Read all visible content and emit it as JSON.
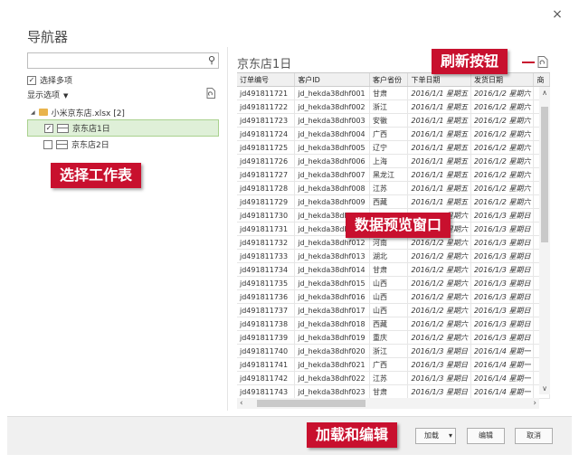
{
  "dialog": {
    "title": "导航器",
    "close_label": "×",
    "search": {
      "placeholder": "",
      "icon": "search-icon"
    },
    "select_multiple_label": "选择多项",
    "display_options_label": "显示选项",
    "display_options_arrow": "▼"
  },
  "tree": {
    "folder_label": "小米京东店.xlsx [2]",
    "items": [
      {
        "label": "京东店1日",
        "checked": "✓",
        "selected": true
      },
      {
        "label": "京东店2日",
        "checked": "",
        "selected": false
      }
    ]
  },
  "preview": {
    "title": "京东店1日",
    "columns": [
      "订单编号",
      "客户ID",
      "客户省份",
      "下单日期",
      "发货日期",
      "商"
    ],
    "rows": [
      [
        "jd491811721",
        "jd_hekda38dhf001",
        "甘肃",
        "2016/1/1 星期五",
        "2016/1/2 星期六"
      ],
      [
        "jd491811722",
        "jd_hekda38dhf002",
        "浙江",
        "2016/1/1 星期五",
        "2016/1/2 星期六"
      ],
      [
        "jd491811723",
        "jd_hekda38dhf003",
        "安徽",
        "2016/1/1 星期五",
        "2016/1/2 星期六"
      ],
      [
        "jd491811724",
        "jd_hekda38dhf004",
        "广西",
        "2016/1/1 星期五",
        "2016/1/2 星期六"
      ],
      [
        "jd491811725",
        "jd_hekda38dhf005",
        "辽宁",
        "2016/1/1 星期五",
        "2016/1/2 星期六"
      ],
      [
        "jd491811726",
        "jd_hekda38dhf006",
        "上海",
        "2016/1/1 星期五",
        "2016/1/2 星期六"
      ],
      [
        "jd491811727",
        "jd_hekda38dhf007",
        "黑龙江",
        "2016/1/1 星期五",
        "2016/1/2 星期六"
      ],
      [
        "jd491811728",
        "jd_hekda38dhf008",
        "江苏",
        "2016/1/1 星期五",
        "2016/1/2 星期六"
      ],
      [
        "jd491811729",
        "jd_hekda38dhf009",
        "西藏",
        "2016/1/1 星期五",
        "2016/1/2 星期六"
      ],
      [
        "jd491811730",
        "jd_hekda38dhf010",
        "",
        "2016/1/2 星期六",
        "2016/1/3 星期日"
      ],
      [
        "jd491811731",
        "jd_hekda38dhf011",
        "",
        "2016/1/2 星期六",
        "2016/1/3 星期日"
      ],
      [
        "jd491811732",
        "jd_hekda38dhf012",
        "河南",
        "2016/1/2 星期六",
        "2016/1/3 星期日"
      ],
      [
        "jd491811733",
        "jd_hekda38dhf013",
        "湖北",
        "2016/1/2 星期六",
        "2016/1/3 星期日"
      ],
      [
        "jd491811734",
        "jd_hekda38dhf014",
        "甘肃",
        "2016/1/2 星期六",
        "2016/1/3 星期日"
      ],
      [
        "jd491811735",
        "jd_hekda38dhf015",
        "山西",
        "2016/1/2 星期六",
        "2016/1/3 星期日"
      ],
      [
        "jd491811736",
        "jd_hekda38dhf016",
        "山西",
        "2016/1/2 星期六",
        "2016/1/3 星期日"
      ],
      [
        "jd491811737",
        "jd_hekda38dhf017",
        "山西",
        "2016/1/2 星期六",
        "2016/1/3 星期日"
      ],
      [
        "jd491811738",
        "jd_hekda38dhf018",
        "西藏",
        "2016/1/2 星期六",
        "2016/1/3 星期日"
      ],
      [
        "jd491811739",
        "jd_hekda38dhf019",
        "重庆",
        "2016/1/2 星期六",
        "2016/1/3 星期日"
      ],
      [
        "jd491811740",
        "jd_hekda38dhf020",
        "浙江",
        "2016/1/3 星期日",
        "2016/1/4 星期一"
      ],
      [
        "jd491811741",
        "jd_hekda38dhf021",
        "广西",
        "2016/1/3 星期日",
        "2016/1/4 星期一"
      ],
      [
        "jd491811742",
        "jd_hekda38dhf022",
        "江苏",
        "2016/1/3 星期日",
        "2016/1/4 星期一"
      ],
      [
        "jd491811743",
        "jd_hekda38dhf023",
        "甘肃",
        "2016/1/3 星期日",
        "2016/1/4 星期一"
      ]
    ]
  },
  "footer": {
    "load_label": "加载",
    "load_dropdown": "▾",
    "edit_label": "编辑",
    "cancel_label": "取消"
  },
  "callouts": {
    "refresh": "刷新按钮",
    "select_sheet": "选择工作表",
    "preview_window": "数据预览窗口",
    "load_and_edit": "加载和编辑"
  },
  "colors": {
    "callout": "#c8102e",
    "selected_row": "#dff0d8"
  },
  "scroll": {
    "up": "∧",
    "down": "∨",
    "left": "‹",
    "right": "›"
  }
}
